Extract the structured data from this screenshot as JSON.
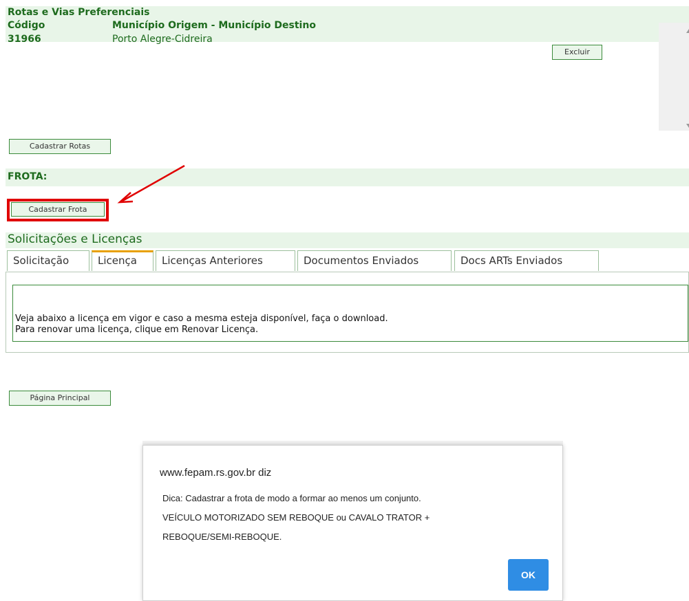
{
  "routes": {
    "title": "Rotas e Vias Preferenciais",
    "columns": [
      "Código",
      "Município Origem - Município Destino"
    ],
    "rows": [
      {
        "code": "31966",
        "route": "Porto Alegre-Cidreira",
        "action": "Excluir"
      }
    ],
    "register_button": "Cadastrar Rotas"
  },
  "fleet": {
    "label": "FROTA:",
    "register_button": "Cadastrar Frota"
  },
  "requests": {
    "title": "Solicitações e Licenças",
    "tabs": [
      "Solicitação",
      "Licença",
      "Licenças Anteriores",
      "Documentos Enviados",
      "Docs ARTs Enviados"
    ],
    "active_tab": "Licença",
    "message_lines": [
      "Veja abaixo a licença em vigor e caso a mesma esteja disponível, faça o download.",
      "Para renovar uma licença, clique em Renovar Licença."
    ]
  },
  "main_page_button": "Página Principal",
  "dialog": {
    "title": "www.fepam.rs.gov.br diz",
    "lines": [
      " Dica: Cadastrar a frota de modo a formar ao menos um conjunto.",
      "VEÍCULO MOTORIZADO SEM REBOQUE ou CAVALO TRATOR +",
      "REBOQUE/SEMI-REBOQUE."
    ],
    "ok_label": "OK"
  },
  "colors": {
    "accent_green": "#1e6b1e",
    "section_bar": "#e8f5e8",
    "highlight_red": "#e00000",
    "ok_blue": "#2f8de4"
  }
}
